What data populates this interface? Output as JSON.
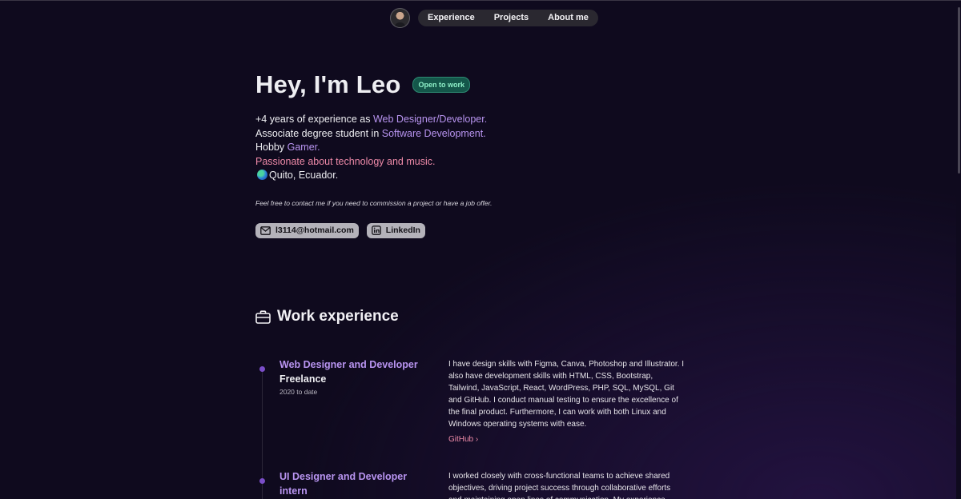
{
  "nav": {
    "avatar_alt": "Leo avatar",
    "links": [
      "Experience",
      "Projects",
      "About me"
    ]
  },
  "hero": {
    "title": "Hey, I'm Leo",
    "badge": "Open to work",
    "bio": [
      {
        "prefix": "+4 years of experience as ",
        "accent": "Web Designer/Developer."
      },
      {
        "prefix": "Associate degree student in ",
        "accent": "Software Development."
      },
      {
        "prefix": "Hobby ",
        "accent": "Gamer."
      },
      {
        "pink": "Passionate about technology and music."
      },
      {
        "location": "Quito, Ecuador."
      }
    ],
    "contact_note": "Feel free to contact me if you need to commission a project or have a job offer.",
    "email_label": "l3114@hotmail.com",
    "linkedin_label": "LinkedIn"
  },
  "work": {
    "heading": "Work experience",
    "jobs": [
      {
        "role": "Web Designer and Developer",
        "company": "Freelance",
        "date": "2020 to date",
        "description": "I have design skills with Figma, Canva, Photoshop and Illustrator. I also have development skills with HTML, CSS, Bootstrap, Tailwind, JavaScript, React, WordPress, PHP, SQL, MySQL, Git and GitHub. I conduct manual testing to ensure the excellence of the final product. Furthermore, I can work with both Linux and Windows operating systems with ease.",
        "link": "GitHub"
      },
      {
        "role": "UI Designer and Developer intern",
        "description": "I worked closely with cross-functional teams to achieve shared objectives, driving project success through collaborative efforts and maintaining open lines of communication. My experience"
      }
    ]
  }
}
